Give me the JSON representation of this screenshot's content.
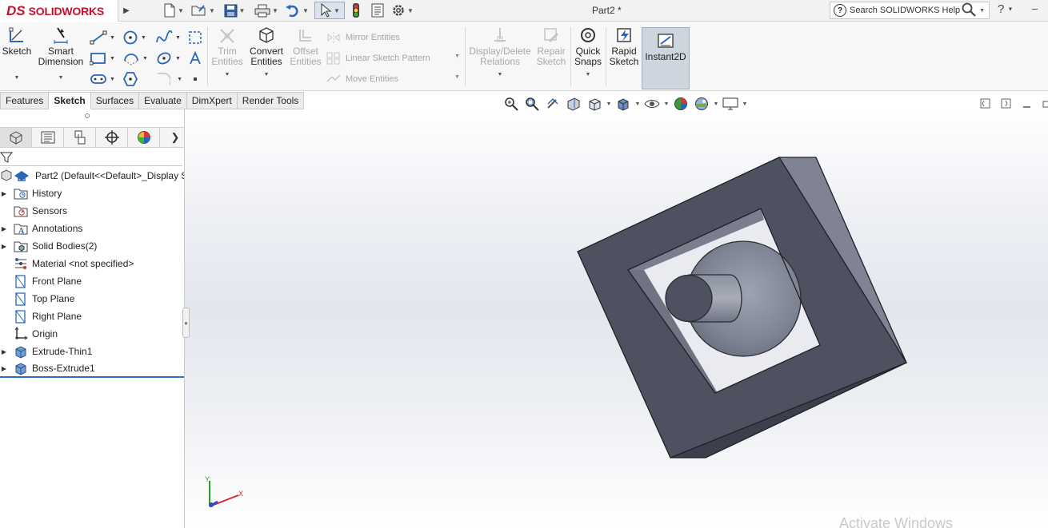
{
  "app": {
    "logo_ds": "DS",
    "logo_text": "SOLIDWORKS",
    "document_title": "Part2 *",
    "search_placeholder": "Search SOLIDWORKS Help"
  },
  "ribbon": {
    "sketch": "Sketch",
    "smart_dimension_1": "Smart",
    "smart_dimension_2": "Dimension",
    "trim_1": "Trim",
    "trim_2": "Entities",
    "convert_1": "Convert",
    "convert_2": "Entities",
    "offset_1": "Offset",
    "offset_2": "Entities",
    "mirror": "Mirror Entities",
    "linear_pattern": "Linear Sketch Pattern",
    "move": "Move Entities",
    "display_relations_1": "Display/Delete",
    "display_relations_2": "Relations",
    "repair_1": "Repair",
    "repair_2": "Sketch",
    "quick_snaps_1": "Quick",
    "quick_snaps_2": "Snaps",
    "rapid_sketch_1": "Rapid",
    "rapid_sketch_2": "Sketch",
    "instant2d": "Instant2D"
  },
  "tabs": [
    "Features",
    "Sketch",
    "Surfaces",
    "Evaluate",
    "DimXpert",
    "Render Tools"
  ],
  "active_tab": "Sketch",
  "tree": {
    "root": "Part2  (Default<<Default>_Display S",
    "items": [
      {
        "label": "History",
        "icon": "history-folder-icon",
        "expand": true
      },
      {
        "label": "Sensors",
        "icon": "sensors-folder-icon",
        "expand": false
      },
      {
        "label": "Annotations",
        "icon": "annotations-icon",
        "expand": true
      },
      {
        "label": "Solid Bodies(2)",
        "icon": "solid-bodies-icon",
        "expand": true
      },
      {
        "label": "Material <not specified>",
        "icon": "material-icon",
        "expand": false
      },
      {
        "label": "Front Plane",
        "icon": "plane-icon",
        "expand": false
      },
      {
        "label": "Top Plane",
        "icon": "plane-icon",
        "expand": false
      },
      {
        "label": "Right Plane",
        "icon": "plane-icon",
        "expand": false
      },
      {
        "label": "Origin",
        "icon": "origin-icon",
        "expand": false
      },
      {
        "label": "Extrude-Thin1",
        "icon": "extrude-icon",
        "expand": true
      },
      {
        "label": "Boss-Extrude1",
        "icon": "extrude-icon",
        "expand": true
      }
    ]
  },
  "triad": {
    "x": "X",
    "y": "Y"
  },
  "watermark": "Activate Windows",
  "colors": {
    "brand_red": "#c8102e",
    "model_face": "#4e5160",
    "model_side": "#7f8393",
    "accent_blue": "#2f6fbf"
  }
}
